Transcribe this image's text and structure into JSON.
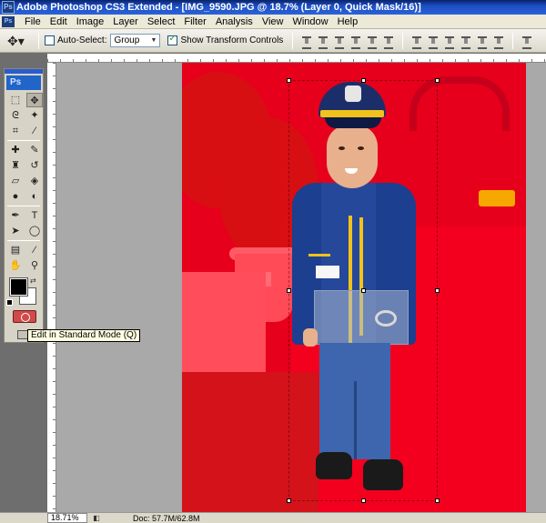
{
  "window": {
    "title": "Adobe Photoshop CS3 Extended - [IMG_9590.JPG @ 18.7% (Layer 0, Quick Mask/16)]"
  },
  "menu": {
    "items": [
      "File",
      "Edit",
      "Image",
      "Layer",
      "Select",
      "Filter",
      "Analysis",
      "View",
      "Window",
      "Help"
    ]
  },
  "options_bar": {
    "auto_select_label": "Auto-Select:",
    "auto_select_checked": false,
    "auto_select_value": "Group",
    "show_transform_label": "Show Transform Controls",
    "show_transform_checked": true
  },
  "toolbox": {
    "logo": "Ps",
    "tooltip": "Edit in Standard Mode (Q)",
    "foreground_color": "#000000",
    "background_color": "#ffffff"
  },
  "status": {
    "zoom": "18.71%",
    "doc_size": "Doc: 57.7M/62.8M"
  },
  "colors": {
    "quick_mask_overlay": "#e6001b"
  }
}
